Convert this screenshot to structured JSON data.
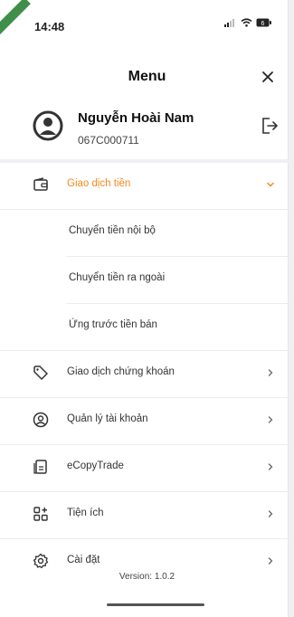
{
  "status": {
    "time": "14:48"
  },
  "header": {
    "title": "Menu"
  },
  "profile": {
    "name": "Nguyễn Hoài Nam",
    "id": "067C000711"
  },
  "menu": {
    "items": [
      {
        "label": "Giao dịch tiền",
        "active": true
      },
      {
        "label": "Giao dịch chứng khoán"
      },
      {
        "label": "Quản lý tài khoản"
      },
      {
        "label": "eCopyTrade"
      },
      {
        "label": "Tiện ích"
      },
      {
        "label": "Cài đặt"
      }
    ],
    "submenu": [
      {
        "label": "Chuyển tiền nội bộ"
      },
      {
        "label": "Chuyển tiền ra ngoài"
      },
      {
        "label": "Ứng trước tiền bán"
      }
    ]
  },
  "footer": {
    "version": "Version: 1.0.2"
  },
  "colors": {
    "accent": "#f28a1e",
    "divider": "#eef0f6"
  }
}
